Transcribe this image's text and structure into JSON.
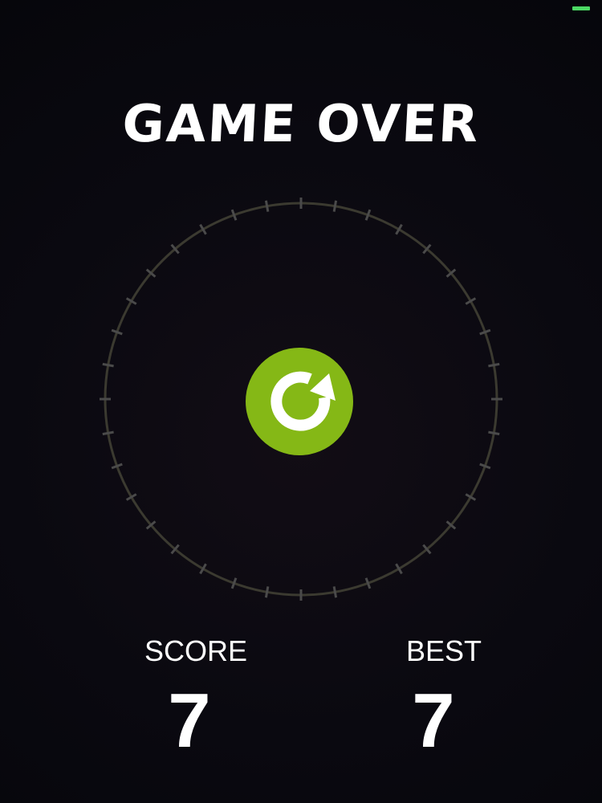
{
  "status_bar": {
    "battery_color": "#4cd964"
  },
  "title": "GAME OVER",
  "ring": {
    "color": "#3b3a30",
    "tick_count": 36
  },
  "restart_button": {
    "icon": "restart-icon",
    "color": "#85b816"
  },
  "score": {
    "label": "SCORE",
    "value": "7"
  },
  "best": {
    "label": "BEST",
    "value": "7"
  }
}
